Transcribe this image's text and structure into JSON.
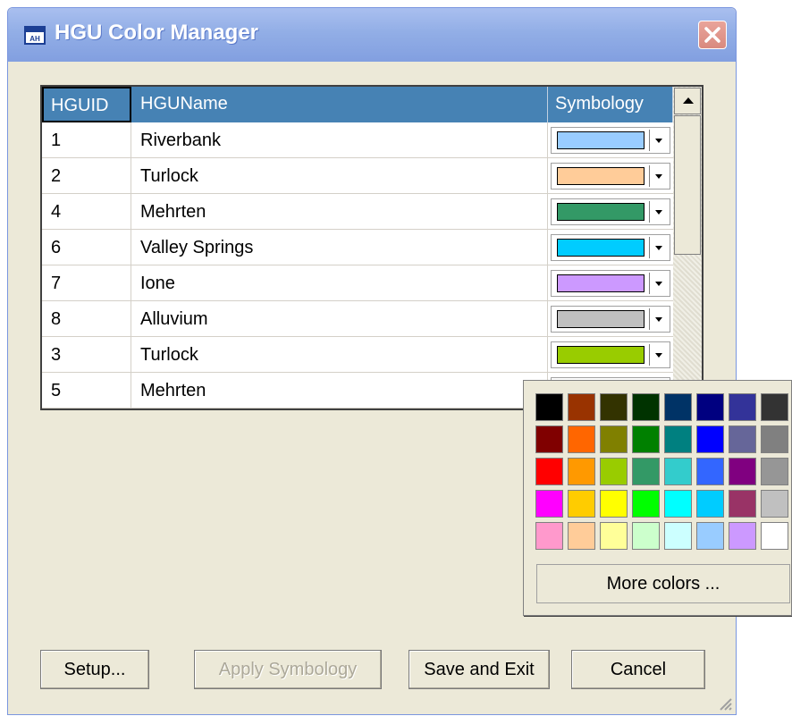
{
  "window": {
    "title": "HGU Color Manager",
    "icon": "table-app-icon"
  },
  "grid": {
    "columns": [
      "HGUID",
      "HGUName",
      "Symbology"
    ],
    "rows": [
      {
        "id": "1",
        "name": "Riverbank",
        "color": "#99ccff"
      },
      {
        "id": "2",
        "name": "Turlock",
        "color": "#ffcc99"
      },
      {
        "id": "4",
        "name": "Mehrten",
        "color": "#339966"
      },
      {
        "id": "6",
        "name": "Valley Springs",
        "color": "#00ccff"
      },
      {
        "id": "7",
        "name": "Ione",
        "color": "#cc99ff"
      },
      {
        "id": "8",
        "name": "Alluvium",
        "color": "#c0c0c0"
      },
      {
        "id": "3",
        "name": "Turlock",
        "color": "#99cc00"
      },
      {
        "id": "5",
        "name": "Mehrten",
        "color": "#ffffff"
      }
    ]
  },
  "color_popup": {
    "palette": [
      [
        "#000000",
        "#993300",
        "#333300",
        "#003300",
        "#003366",
        "#000080",
        "#333399",
        "#333333"
      ],
      [
        "#800000",
        "#ff6600",
        "#808000",
        "#008000",
        "#008080",
        "#0000ff",
        "#666699",
        "#808080"
      ],
      [
        "#ff0000",
        "#ff9900",
        "#99cc00",
        "#339966",
        "#33cccc",
        "#3366ff",
        "#800080",
        "#969696"
      ],
      [
        "#ff00ff",
        "#ffcc00",
        "#ffff00",
        "#00ff00",
        "#00ffff",
        "#00ccff",
        "#993366",
        "#c0c0c0"
      ],
      [
        "#ff99cc",
        "#ffcc99",
        "#ffff99",
        "#ccffcc",
        "#ccffff",
        "#99ccff",
        "#cc99ff",
        "#ffffff"
      ]
    ],
    "more_label": "More colors ..."
  },
  "buttons": {
    "setup": "Setup...",
    "apply": "Apply Symbology",
    "save_exit": "Save and Exit",
    "cancel": "Cancel"
  }
}
